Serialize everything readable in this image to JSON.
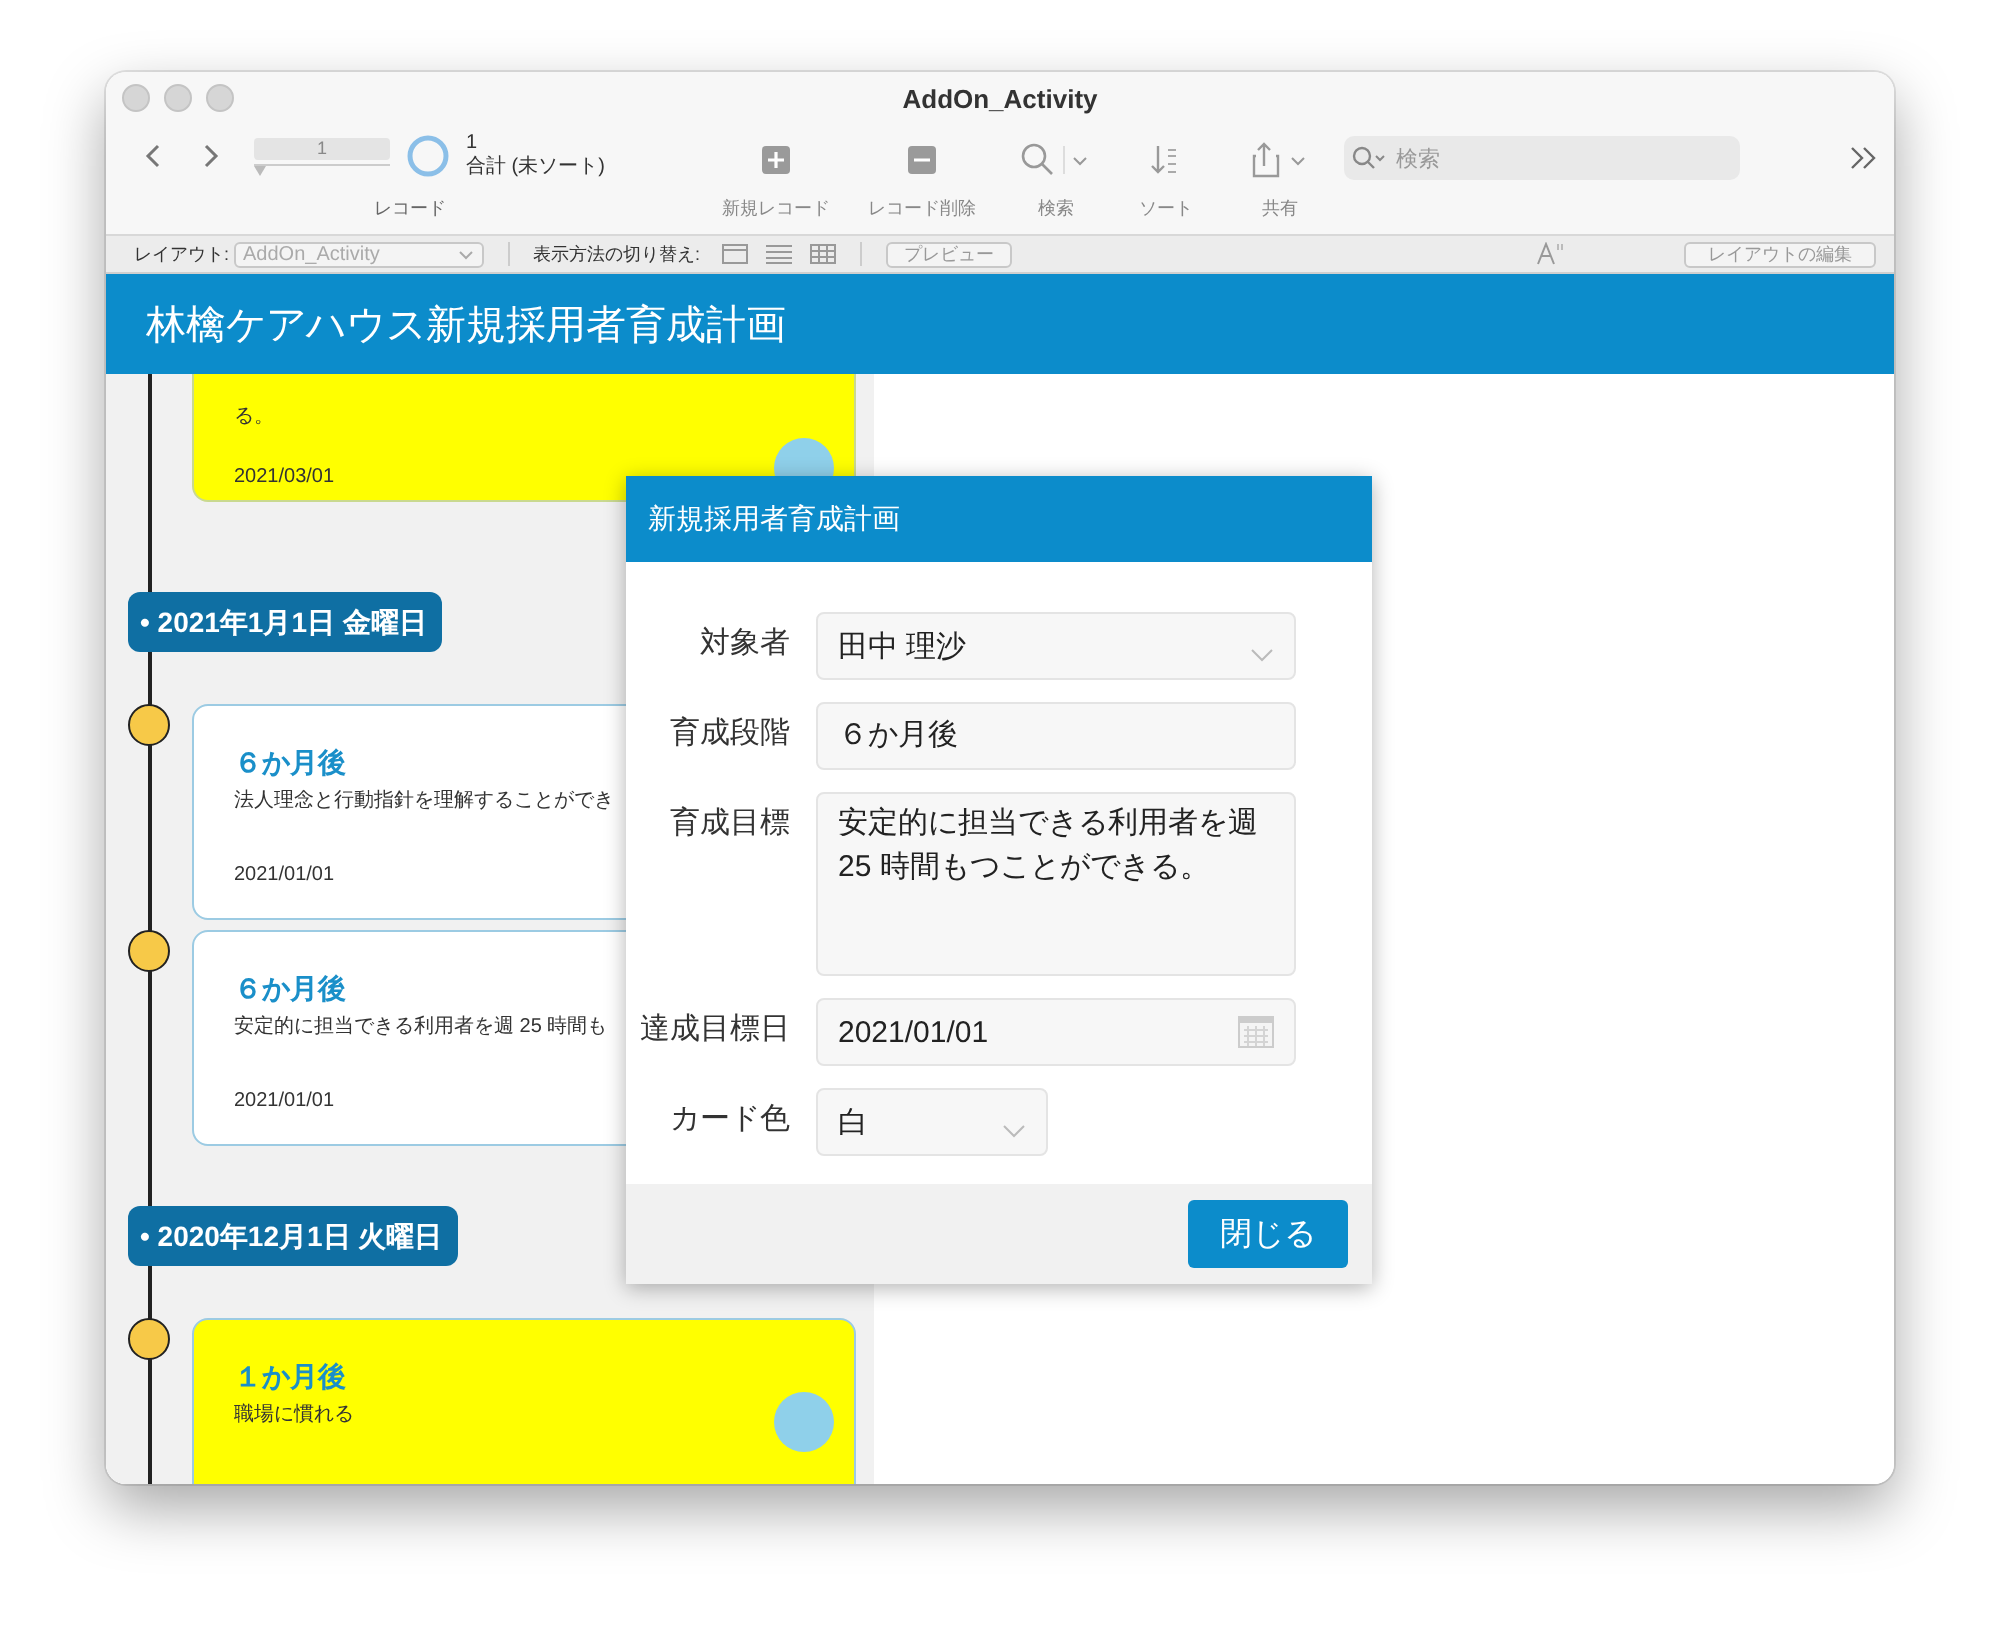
{
  "window": {
    "title": "AddOn_Activity"
  },
  "toolbar": {
    "record_number": "1",
    "record_slider": {
      "level": 0
    },
    "record_label": "レコード",
    "found_count": "1",
    "found_label": "合計 (未ソート)",
    "buttons": [
      {
        "kind": "new",
        "label": "新規レコード"
      },
      {
        "kind": "delete",
        "label": "レコード削除"
      },
      {
        "kind": "search",
        "label": "検索"
      },
      {
        "kind": "sort",
        "label": "ソート"
      },
      {
        "kind": "share",
        "label": "共有"
      }
    ],
    "search": {
      "placeholder": "検索"
    }
  },
  "layout_bar": {
    "layout_label": "レイアウト:",
    "layout_value": "AddOn_Activity",
    "view_label": "表示方法の切り替え:",
    "views": [
      {
        "kind": "form"
      },
      {
        "kind": "list"
      },
      {
        "kind": "table"
      }
    ],
    "preview_button": "プレビュー",
    "edit_button": "レイアウトの編集"
  },
  "header": {
    "title": "林檎ケアハウス新規採用者育成計画"
  },
  "timeline": [
    {
      "kind": "card",
      "color": "#ffff00",
      "marker": false,
      "cut_top": true,
      "description": "る。",
      "date": "2021/03/01",
      "avatar": true
    },
    {
      "kind": "date",
      "label": "• 2021年1月1日 金曜日"
    },
    {
      "kind": "card",
      "color": "#ffffff",
      "marker": true,
      "title": "６か月後",
      "description": "法人理念と行動指針を理解することができ",
      "date": "2021/01/01",
      "avatar": false
    },
    {
      "kind": "card",
      "color": "#ffffff",
      "marker": true,
      "title": "６か月後",
      "description": "安定的に担当できる利用者を週 25 時間も",
      "date": "2021/01/01",
      "avatar": false
    },
    {
      "kind": "date",
      "label": "• 2020年12月1日 火曜日"
    },
    {
      "kind": "card",
      "color": "#ffff00",
      "marker": true,
      "title": "１か月後",
      "description": "職場に慣れる",
      "avatar": true
    }
  ],
  "dialog": {
    "title": "新規採用者育成計画",
    "fields": [
      {
        "kind": "select",
        "label": "対象者",
        "value": "田中 理沙"
      },
      {
        "kind": "text",
        "label": "育成段階",
        "value": "６か月後"
      },
      {
        "kind": "textarea",
        "label": "育成目標",
        "value": "安定的に担当できる利用者を週 25 時間もつことができる。"
      },
      {
        "kind": "date",
        "label": "達成目標日",
        "value": "2021/01/01"
      },
      {
        "kind": "short_select",
        "label": "カード色",
        "value": "白"
      }
    ],
    "close_button": "閉じる"
  }
}
